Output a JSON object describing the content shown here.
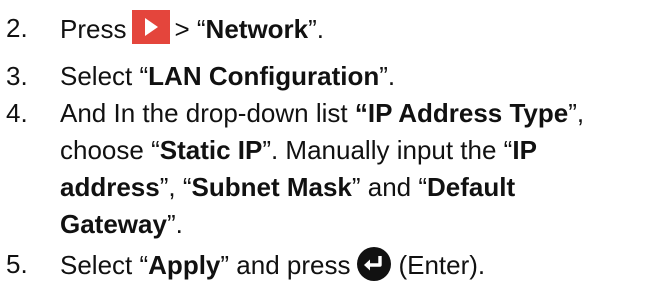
{
  "steps": [
    {
      "num": "2.",
      "parts": {
        "a": "Press",
        "b": "> “",
        "c": "Network",
        "d": "”."
      }
    },
    {
      "num": "3.",
      "parts": {
        "a": "Select “",
        "b": "LAN Configuration",
        "c": "”."
      }
    },
    {
      "num": "4.",
      "line1": {
        "a": "And In the drop-down list ",
        "b": "“IP Address Type",
        "c": "”,"
      },
      "line2": {
        "a": "choose “",
        "b": "Static IP",
        "c": "”. Manually input the “",
        "d": "IP"
      },
      "line3": {
        "a": "address",
        "b": "”, “",
        "c": "Subnet Mask",
        "d": "” and “",
        "e": "Default"
      },
      "line4": {
        "a": "Gateway",
        "b": "”."
      }
    },
    {
      "num": "5.",
      "parts": {
        "a": "Select “",
        "b": "Apply",
        "c": "” and press",
        "d": "(Enter)."
      }
    }
  ],
  "icons": {
    "play": "play-button-icon",
    "enter": "enter-key-icon",
    "play_color": "#e4453c",
    "enter_color": "#111111"
  }
}
